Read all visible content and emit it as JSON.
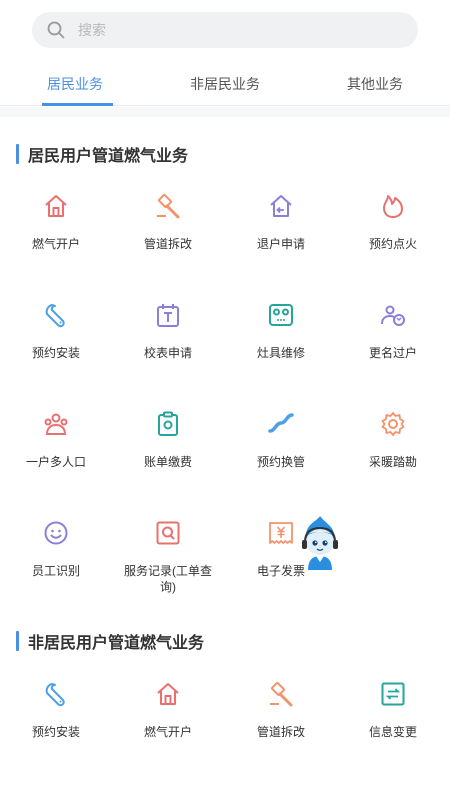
{
  "search": {
    "placeholder": "搜索"
  },
  "tabs": [
    {
      "label": "居民业务",
      "active": true
    },
    {
      "label": "非居民业务",
      "active": false
    },
    {
      "label": "其他业务",
      "active": false
    }
  ],
  "colors": {
    "accent": "#4a90e2",
    "red": "#e8716f",
    "orange": "#f3936b",
    "purple": "#8d7ed8",
    "blue": "#4da0e4",
    "teal": "#26a69a"
  },
  "sections": [
    {
      "title": "居民用户管道燃气业务",
      "items": [
        {
          "label": "燃气开户",
          "icon": "house-icon"
        },
        {
          "label": "管道拆改",
          "icon": "hammer-icon"
        },
        {
          "label": "退户申请",
          "icon": "house-return-icon"
        },
        {
          "label": "预约点火",
          "icon": "flame-icon"
        },
        {
          "label": "预约安装",
          "icon": "wrench-icon"
        },
        {
          "label": "校表申请",
          "icon": "meter-calendar-icon"
        },
        {
          "label": "灶具维修",
          "icon": "stove-icon"
        },
        {
          "label": "更名过户",
          "icon": "people-transfer-icon"
        },
        {
          "label": "一户多人口",
          "icon": "family-icon"
        },
        {
          "label": "账单缴费",
          "icon": "clipboard-icon"
        },
        {
          "label": "预约换管",
          "icon": "pipe-icon"
        },
        {
          "label": "采暖踏勘",
          "icon": "gear-icon"
        },
        {
          "label": "员工识别",
          "icon": "smiley-icon"
        },
        {
          "label": "服务记录(工单查询)",
          "icon": "record-search-icon"
        },
        {
          "label": "电子发票",
          "icon": "invoice-icon"
        }
      ]
    },
    {
      "title": "非居民用户管道燃气业务",
      "items": [
        {
          "label": "预约安装",
          "icon": "wrench-icon"
        },
        {
          "label": "燃气开户",
          "icon": "house-icon"
        },
        {
          "label": "管道拆改",
          "icon": "hammer-icon"
        },
        {
          "label": "信息变更",
          "icon": "exchange-icon"
        }
      ]
    }
  ]
}
